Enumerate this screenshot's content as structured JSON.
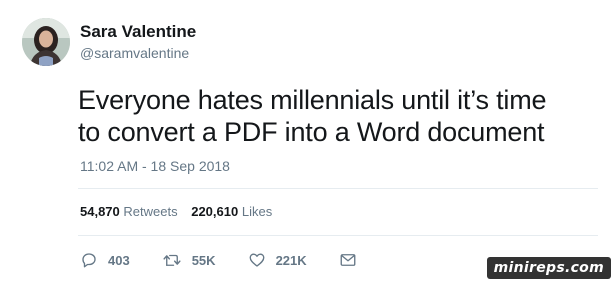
{
  "user": {
    "display_name": "Sara Valentine",
    "handle": "@saramvalentine",
    "avatar_icon": "profile-photo"
  },
  "tweet": {
    "text_lines": [
      "Everyone hates millennials until it’s time",
      "to convert a PDF into a Word document"
    ],
    "timestamp": "11:02 AM - 18 Sep 2018"
  },
  "stats": {
    "retweets_count": "54,870",
    "retweets_label": "Retweets",
    "likes_count": "220,610",
    "likes_label": "Likes"
  },
  "actions": {
    "reply": {
      "icon": "reply-icon",
      "count": "403"
    },
    "retweet": {
      "icon": "retweet-icon",
      "count": "55K"
    },
    "like": {
      "icon": "heart-icon",
      "count": "221K"
    },
    "message": {
      "icon": "envelope-icon"
    }
  },
  "watermark": {
    "text": "minireps.com"
  },
  "colors": {
    "text": "#14171a",
    "secondary": "#657786",
    "divider": "#e6ecf0"
  }
}
